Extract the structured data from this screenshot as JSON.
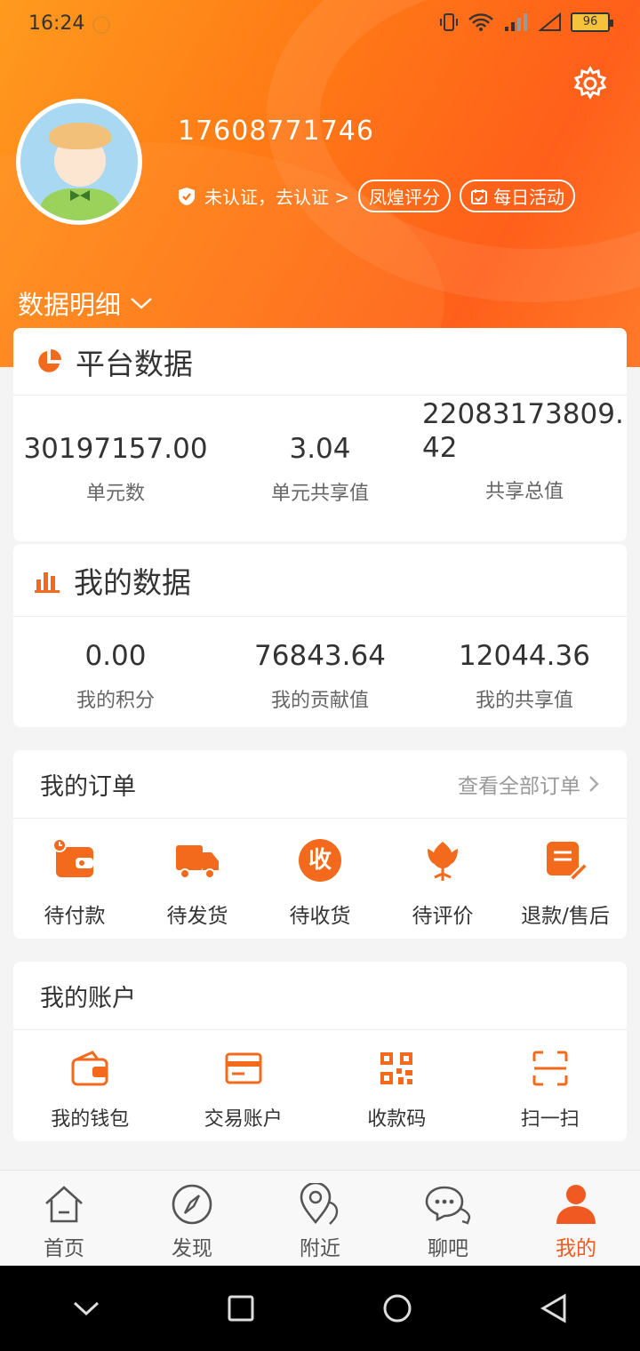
{
  "status": {
    "time": "16:24",
    "battery": "96"
  },
  "profile": {
    "phone": "17608771746",
    "auth_text": "未认证，去认证 >",
    "badge_rating": "凤煌评分",
    "badge_activity": "每日活动"
  },
  "detail_title": "数据明细",
  "platform": {
    "title": "平台数据",
    "stats": [
      {
        "value": "30197157.00",
        "label": "单元数"
      },
      {
        "value": "3.04",
        "label": "单元共享值"
      },
      {
        "value": "22083173809.42",
        "value_line1": "22083173809.",
        "value_line2": "42",
        "label": "共享总值"
      }
    ]
  },
  "mine": {
    "title": "我的数据",
    "stats": [
      {
        "value": "0.00",
        "label": "我的积分"
      },
      {
        "value": "76843.64",
        "label": "我的贡献值"
      },
      {
        "value": "12044.36",
        "label": "我的共享值"
      }
    ]
  },
  "orders": {
    "title": "我的订单",
    "view_all": "查看全部订单",
    "items": [
      {
        "label": "待付款",
        "icon": "wallet-clock-icon"
      },
      {
        "label": "待发货",
        "icon": "truck-icon"
      },
      {
        "label": "待收货",
        "icon": "receive-icon",
        "icon_text": "收"
      },
      {
        "label": "待评价",
        "icon": "flower-icon"
      },
      {
        "label": "退款/售后",
        "icon": "note-edit-icon"
      }
    ]
  },
  "account": {
    "title": "我的账户",
    "items": [
      {
        "label": "我的钱包",
        "icon": "wallet-icon"
      },
      {
        "label": "交易账户",
        "icon": "card-icon"
      },
      {
        "label": "收款码",
        "icon": "qrcode-icon"
      },
      {
        "label": "扫一扫",
        "icon": "scan-icon"
      }
    ]
  },
  "tabs": [
    {
      "label": "首页",
      "icon": "home-icon"
    },
    {
      "label": "发现",
      "icon": "compass-icon"
    },
    {
      "label": "附近",
      "icon": "location-icon"
    },
    {
      "label": "聊吧",
      "icon": "chat-icon"
    },
    {
      "label": "我的",
      "icon": "person-icon",
      "active": true
    }
  ],
  "colors": {
    "accent": "#f05a22",
    "hero_start": "#ff9a1e",
    "hero_end": "#ff5f1a"
  }
}
